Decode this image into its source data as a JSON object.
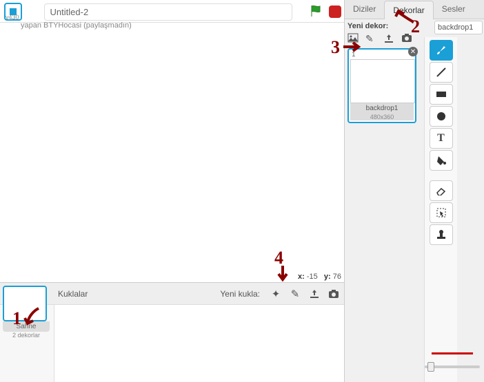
{
  "header": {
    "version": "v430",
    "title_value": "Untitled-2",
    "author_line": "yapan BTYHocasi (paylaşmadın)"
  },
  "stage": {
    "coords_x_label": "x:",
    "coords_x_value": "-15",
    "coords_y_label": "y:",
    "coords_y_value": "76"
  },
  "sprite_panel": {
    "list_title": "Kuklalar",
    "new_sprite_label": "Yeni kukla:",
    "stage_thumb": {
      "label": "Sahne",
      "sub": "2 dekorlar"
    }
  },
  "right": {
    "tabs": {
      "diziler": "Diziler",
      "dekorlar": "Dekorlar",
      "sesler": "Sesler"
    },
    "yeni_dekor": "Yeni dekor:",
    "costume": {
      "index": "1",
      "name": "backdrop1",
      "dim": "480x360"
    },
    "name_input": "backdrop1"
  },
  "annotations": {
    "a1": "1",
    "a2": "2",
    "a3": "3",
    "a4": "4"
  }
}
